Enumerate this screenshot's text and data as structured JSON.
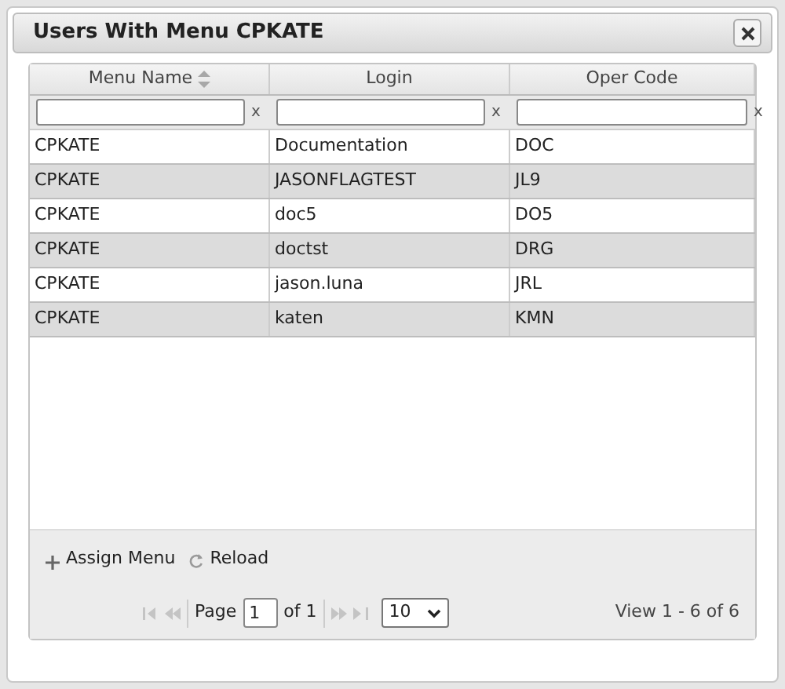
{
  "dialog": {
    "title": "Users With Menu CPKATE"
  },
  "table": {
    "columns": [
      {
        "label": "Menu Name",
        "sorted": true,
        "filter_clear": "x"
      },
      {
        "label": "Login",
        "sorted": false,
        "filter_clear": "x"
      },
      {
        "label": "Oper Code",
        "sorted": false,
        "filter_clear": "x"
      }
    ],
    "rows": [
      [
        "CPKATE",
        "Documentation",
        "DOC"
      ],
      [
        "CPKATE",
        "JASONFLAGTEST",
        "JL9"
      ],
      [
        "CPKATE",
        "doc5",
        "DO5"
      ],
      [
        "CPKATE",
        "doctst",
        "DRG"
      ],
      [
        "CPKATE",
        "jason.luna",
        "JRL"
      ],
      [
        "CPKATE",
        "katen",
        "KMN"
      ]
    ]
  },
  "toolbar": {
    "buttons": [
      {
        "kind": "add",
        "label": "Assign Menu"
      },
      {
        "kind": "reload",
        "label": "Reload"
      }
    ]
  },
  "pager": {
    "page_label": "Page",
    "page": "1",
    "of_label": "of 1",
    "page_size": "10",
    "view": "View 1 - 6 of 6"
  }
}
